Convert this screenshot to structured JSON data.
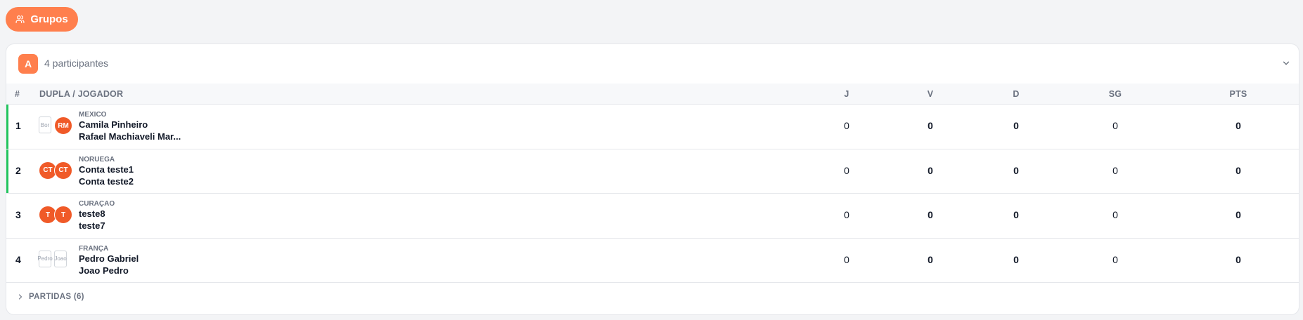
{
  "tab": {
    "label": "Grupos",
    "icon": "users-icon"
  },
  "group": {
    "badge": "A",
    "participants": "4 participantes"
  },
  "table": {
    "headers": {
      "rank": "#",
      "team": "DUPLA / JOGADOR",
      "j": "J",
      "v": "V",
      "d": "D",
      "sg": "SG",
      "pts": "PTS"
    },
    "rows": [
      {
        "rank": "1",
        "country": "MEXICO",
        "player1": "Camila Pinheiro",
        "player2": "Rafael Machiaveli Mar...",
        "avatar1": "Bor",
        "avatar2": "RM",
        "j": "0",
        "v": "0",
        "d": "0",
        "sg": "0",
        "pts": "0"
      },
      {
        "rank": "2",
        "country": "NORUEGA",
        "player1": "Conta teste1",
        "player2": "Conta teste2",
        "avatar1": "CT",
        "avatar2": "CT",
        "j": "0",
        "v": "0",
        "d": "0",
        "sg": "0",
        "pts": "0"
      },
      {
        "rank": "3",
        "country": "CURAÇAO",
        "player1": "teste8",
        "player2": "teste7",
        "avatar1": "T",
        "avatar2": "T",
        "j": "0",
        "v": "0",
        "d": "0",
        "sg": "0",
        "pts": "0"
      },
      {
        "rank": "4",
        "country": "FRANÇA",
        "player1": "Pedro Gabriel",
        "player2": "Joao Pedro",
        "avatar1": "Pedro",
        "avatar2": "Joao",
        "j": "0",
        "v": "0",
        "d": "0",
        "sg": "0",
        "pts": "0"
      }
    ]
  },
  "footer": {
    "label": "PARTIDAS (6)"
  },
  "colors": {
    "accent": "#ff7f4d",
    "avatar": "#f05a28",
    "qualified": "#22c55e"
  }
}
